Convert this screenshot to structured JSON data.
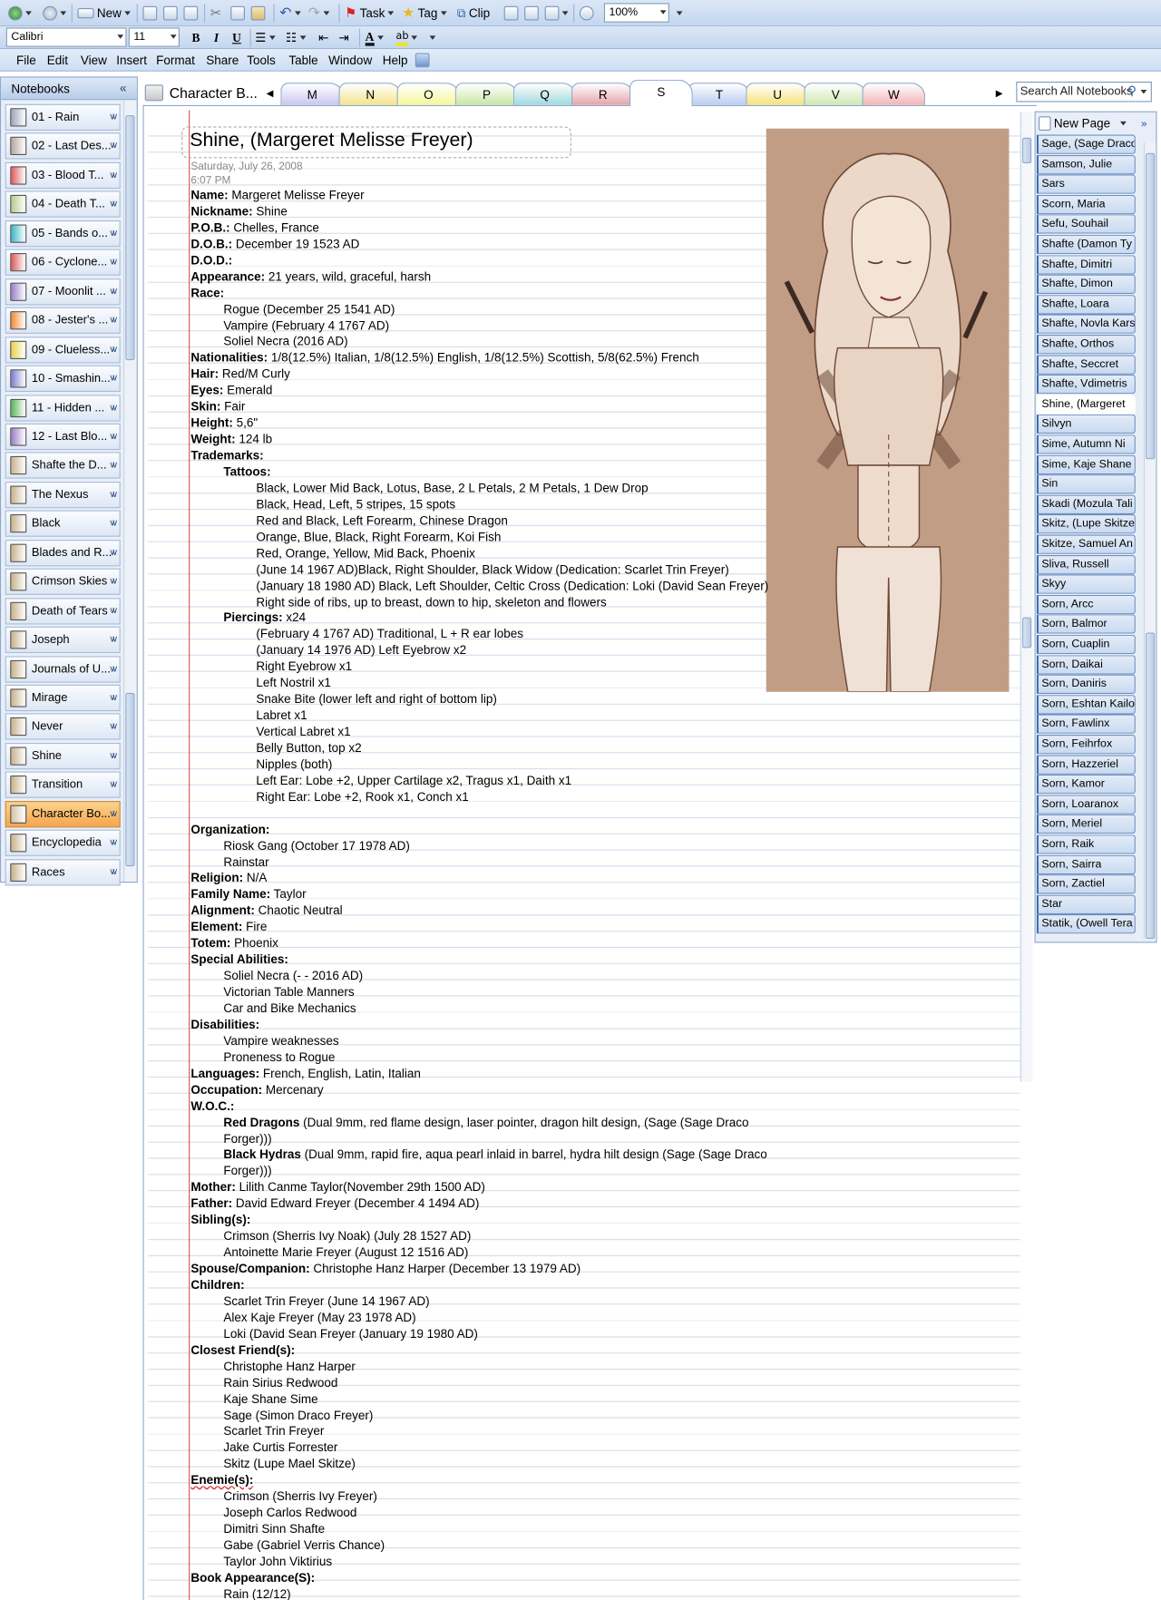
{
  "toolbar": {
    "new_label": "New",
    "task_label": "Task",
    "tag_label": "Tag",
    "clip_label": "Clip",
    "zoom": "100%",
    "font": "Calibri",
    "font_size": "11",
    "bold": "B",
    "italic": "I",
    "underline": "U"
  },
  "menu": [
    "File",
    "Edit",
    "View",
    "Insert",
    "Format",
    "Share",
    "Tools",
    "Table",
    "Window",
    "Help"
  ],
  "nav": {
    "title": "Notebooks",
    "collapse": "«",
    "items": [
      {
        "label": "01 - Rain",
        "color": "#9aa6b8"
      },
      {
        "label": "02 - Last Des...",
        "color": "#b7a6a0"
      },
      {
        "label": "03 - Blood T...",
        "color": "#e05a5a"
      },
      {
        "label": "04 - Death T...",
        "color": "#b9c98a"
      },
      {
        "label": "05 - Bands o...",
        "color": "#39b7c9"
      },
      {
        "label": "06 - Cyclone...",
        "color": "#e05a5a"
      },
      {
        "label": "07 - Moonlit ...",
        "color": "#9a7fc6"
      },
      {
        "label": "08 - Jester's ...",
        "color": "#f08a3a"
      },
      {
        "label": "09 - Clueless...",
        "color": "#e8d34a"
      },
      {
        "label": "10 - Smashin...",
        "color": "#7b7fd0"
      },
      {
        "label": "11 - Hidden ...",
        "color": "#5ab55a"
      },
      {
        "label": "12 - Last Blo...",
        "color": "#9a7fc6"
      },
      {
        "label": "Shafte the D...",
        "color": "#c8b28a"
      },
      {
        "label": "The Nexus",
        "color": "#c8b28a"
      },
      {
        "label": "Black",
        "color": "#c8b28a"
      },
      {
        "label": "Blades and R...",
        "color": "#c8b28a"
      },
      {
        "label": "Crimson Skies",
        "color": "#c8b28a"
      },
      {
        "label": "Death of Tears",
        "color": "#c8b28a"
      },
      {
        "label": "Joseph",
        "color": "#c8b28a"
      },
      {
        "label": "Journals of U...",
        "color": "#c8b28a"
      },
      {
        "label": "Mirage",
        "color": "#c8b28a"
      },
      {
        "label": "Never",
        "color": "#c8b28a"
      },
      {
        "label": "Shine",
        "color": "#c8b28a"
      },
      {
        "label": "Transition",
        "color": "#c8b28a"
      },
      {
        "label": "Character Bo...",
        "color": "#d4c3a6",
        "active": true
      },
      {
        "label": "Encyclopedia",
        "color": "#c8b28a"
      },
      {
        "label": "Races",
        "color": "#c8b28a"
      }
    ]
  },
  "notebook_title": "Character B...",
  "sections": [
    {
      "label": "M",
      "color": "#c9c7f0"
    },
    {
      "label": "N",
      "color": "#f4e38a"
    },
    {
      "label": "O",
      "color": "#f6f79a"
    },
    {
      "label": "P",
      "color": "#c8e6a4"
    },
    {
      "label": "Q",
      "color": "#9fd8df"
    },
    {
      "label": "R",
      "color": "#e4a3a8"
    },
    {
      "label": "S",
      "color": "#ffffff"
    },
    {
      "label": "T",
      "color": "#b9cdf0"
    },
    {
      "label": "U",
      "color": "#f6e27a"
    },
    {
      "label": "V",
      "color": "#cfe8b1"
    },
    {
      "label": "W",
      "color": "#f2b3b6"
    }
  ],
  "search_placeholder": "Search All Notebooks",
  "page": {
    "title": "Shine, (Margeret Melisse Freyer)",
    "date": "Saturday, July 26, 2008",
    "time": "6:07 PM",
    "lines": [
      {
        "l": "Name:",
        "t": " Margeret Melisse Freyer",
        "i": 0
      },
      {
        "l": "Nickname:",
        "t": " Shine",
        "i": 0
      },
      {
        "l": "P.O.B.:",
        "t": " Chelles, France",
        "i": 0
      },
      {
        "l": "D.O.B.:",
        "t": " December 19 1523  AD",
        "i": 0
      },
      {
        "l": "D.O.D.:",
        "t": "",
        "i": 0
      },
      {
        "l": "Appearance:",
        "t": " 21 years, wild, graceful, harsh",
        "i": 0
      },
      {
        "l": "Race:",
        "t": "",
        "i": 0
      },
      {
        "l": "",
        "t": "Rogue (December 25 1541 AD)",
        "i": 1
      },
      {
        "l": "",
        "t": "Vampire (February 4 1767 AD)",
        "i": 1
      },
      {
        "l": "",
        "t": "Soliel Necra (2016 AD)",
        "i": 1
      },
      {
        "l": "Nationalities:",
        "t": " 1/8(12.5%) Italian, 1/8(12.5%) English, 1/8(12.5%) Scottish, 5/8(62.5%) French",
        "i": 0
      },
      {
        "l": "Hair:",
        "t": " Red/M Curly",
        "i": 0
      },
      {
        "l": "Eyes:",
        "t": "  Emerald",
        "i": 0
      },
      {
        "l": "Skin:",
        "t": " Fair",
        "i": 0
      },
      {
        "l": "Height:",
        "t": " 5,6\"",
        "i": 0
      },
      {
        "l": "Weight:",
        "t": " 124 lb",
        "i": 0
      },
      {
        "l": "Trademarks:",
        "t": "",
        "i": 0
      },
      {
        "l": "Tattoos:",
        "t": "",
        "i": 1
      },
      {
        "l": "",
        "t": "Black, Lower Mid Back, Lotus, Base, 2 L Petals, 2 M Petals, 1 Dew Drop",
        "i": 2
      },
      {
        "l": "",
        "t": "Black, Head, Left, 5 stripes, 15 spots",
        "i": 2
      },
      {
        "l": "",
        "t": "Red and Black, Left Forearm, Chinese Dragon",
        "i": 2
      },
      {
        "l": "",
        "t": "Orange, Blue, Black, Right Forearm, Koi Fish",
        "i": 2
      },
      {
        "l": "",
        "t": "Red, Orange, Yellow, Mid Back, Phoenix",
        "i": 2
      },
      {
        "l": "",
        "t": "(June 14 1967  AD)Black, Right Shoulder, Black Widow (Dedication: Scarlet Trin Freyer)",
        "i": 2
      },
      {
        "l": "",
        "t": "(January 18 1980  AD) Black, Left Shoulder, Celtic Cross (Dedication: Loki (David Sean Freyer)",
        "i": 2
      },
      {
        "l": "",
        "t": "Right side of ribs, up to breast, down to hip, skeleton and flowers",
        "i": 2
      },
      {
        "l": "Piercings:",
        "t": " x24",
        "i": 1
      },
      {
        "l": "",
        "t": "(February 4 1767  AD) Traditional, L + R ear lobes",
        "i": 2
      },
      {
        "l": "",
        "t": "(January 14 1976  AD) Left Eyebrow  x2",
        "i": 2
      },
      {
        "l": "",
        "t": "Right Eyebrow x1",
        "i": 2
      },
      {
        "l": "",
        "t": "Left Nostril x1",
        "i": 2
      },
      {
        "l": "",
        "t": "Snake Bite (lower left and right of bottom lip)",
        "i": 2
      },
      {
        "l": "",
        "t": "Labret x1",
        "i": 2
      },
      {
        "l": "",
        "t": "Vertical Labret x1",
        "i": 2
      },
      {
        "l": "",
        "t": "Belly Button, top x2",
        "i": 2
      },
      {
        "l": "",
        "t": "Nipples (both)",
        "i": 2
      },
      {
        "l": "",
        "t": "Left Ear: Lobe +2,  Upper Cartilage x2, Tragus x1, Daith x1",
        "i": 2
      },
      {
        "l": "",
        "t": "Right Ear: Lobe +2,  Rook x1, Conch x1",
        "i": 2
      },
      {
        "l": "",
        "t": "",
        "i": 0
      },
      {
        "l": "Organization:",
        "t": "",
        "i": 0
      },
      {
        "l": "",
        "t": "Riosk Gang (October 17 1978  AD)",
        "i": 1
      },
      {
        "l": "",
        "t": "Rainstar",
        "i": 1
      },
      {
        "l": "Religion:",
        "t": " N/A",
        "i": 0
      },
      {
        "l": "Family Name:",
        "t": " Taylor",
        "i": 0
      },
      {
        "l": "Alignment:",
        "t": " Chaotic Neutral",
        "i": 0
      },
      {
        "l": "Element:",
        "t": " Fire",
        "i": 0
      },
      {
        "l": "Totem:",
        "t": " Phoenix",
        "i": 0
      },
      {
        "l": "Special Abilities:",
        "t": "",
        "i": 0
      },
      {
        "l": "",
        "t": "Soliel Necra (- - 2016 AD)",
        "i": 1
      },
      {
        "l": "",
        "t": "Victorian Table Manners",
        "i": 1
      },
      {
        "l": "",
        "t": "Car and Bike Mechanics",
        "i": 1
      },
      {
        "l": "Disabilities:",
        "t": "",
        "i": 0
      },
      {
        "l": "",
        "t": "Vampire weaknesses",
        "i": 1
      },
      {
        "l": "",
        "t": "Proneness to Rogue",
        "i": 1
      },
      {
        "l": "Languages:",
        "t": " French, English, Latin, Italian",
        "i": 0
      },
      {
        "l": "Occupation:",
        "t": " Mercenary",
        "i": 0
      },
      {
        "l": "W.O.C.:",
        "t": "",
        "i": 0
      },
      {
        "l": "Red Dragons",
        "t": " (Dual 9mm, red flame design, laser pointer, dragon hilt design, (Sage (Sage Draco",
        "i": 1
      },
      {
        "l": "",
        "t": "Forger)))",
        "i": 1
      },
      {
        "l": "Black Hydras",
        "t": " (Dual 9mm, rapid fire, aqua pearl inlaid in barrel, hydra hilt design (Sage (Sage Draco",
        "i": 1
      },
      {
        "l": "",
        "t": "Forger)))",
        "i": 1
      },
      {
        "l": "Mother:",
        "t": " Lilith Canme Taylor(November 29th 1500 AD)",
        "i": 0
      },
      {
        "l": "Father:",
        "t": " David Edward Freyer (December 4 1494  AD)",
        "i": 0
      },
      {
        "l": "Sibling(s):",
        "t": "",
        "i": 0
      },
      {
        "l": "",
        "t": "Crimson (Sherris Ivy Noak)  (July 28 1527 AD)",
        "i": 1
      },
      {
        "l": "",
        "t": "Antoinette Marie Freyer (August 12 1516 AD)",
        "i": 1
      },
      {
        "l": "Spouse/Companion:",
        "t": " Christophe Hanz Harper (December 13 1979  AD)",
        "i": 0
      },
      {
        "l": "Children:",
        "t": "",
        "i": 0
      },
      {
        "l": "",
        "t": "Scarlet Trin Freyer (June 14 1967  AD)",
        "i": 1
      },
      {
        "l": "",
        "t": "Alex Kaje Freyer (May 23 1978  AD)",
        "i": 1
      },
      {
        "l": "",
        "t": "Loki (David Sean Freyer (January 19 1980  AD)",
        "i": 1
      },
      {
        "l": "Closest Friend(s):",
        "t": "",
        "i": 0
      },
      {
        "l": "",
        "t": "Christophe Hanz Harper",
        "i": 1
      },
      {
        "l": "",
        "t": "Rain Sirius Redwood",
        "i": 1
      },
      {
        "l": "",
        "t": "Kaje Shane Sime",
        "i": 1
      },
      {
        "l": "",
        "t": "Sage (Simon Draco Freyer)",
        "i": 1
      },
      {
        "l": "",
        "t": "Scarlet Trin Freyer",
        "i": 1
      },
      {
        "l": "",
        "t": "Jake Curtis Forrester",
        "i": 1
      },
      {
        "l": "",
        "t": "Skitz (Lupe Mael Skitze)",
        "i": 1
      },
      {
        "l": "Enemie(s):",
        "t": "",
        "i": 0
      },
      {
        "l": "",
        "t": "Crimson (Sherris Ivy Freyer)",
        "i": 1
      },
      {
        "l": "",
        "t": "Joseph Carlos Redwood",
        "i": 1
      },
      {
        "l": "",
        "t": "Dimitri Sinn Shafte",
        "i": 1
      },
      {
        "l": "",
        "t": "Gabe (Gabriel Verris Chance)",
        "i": 1
      },
      {
        "l": "",
        "t": "Taylor John Viktirius",
        "i": 1
      },
      {
        "l": "Book Appearance(S):",
        "t": "",
        "i": 0
      },
      {
        "l": "",
        "t": "Rain (12/12)",
        "i": 1
      }
    ]
  },
  "pages_panel": {
    "new_page": "New Page",
    "items": [
      "Sage, (Sage Draco",
      "Samson, Julie",
      "Sars",
      "Scorn, Maria",
      "Sefu, Souhail",
      "Shafte (Damon Ty",
      "Shafte, Dimitri",
      "Shafte, Dimon",
      "Shafte, Loara",
      "Shafte, Novla Kars",
      "Shafte, Orthos",
      "Shafte, Seccret",
      "Shafte, Vdimetris",
      "Shine, (Margeret",
      "Silvyn",
      "Sime, Autumn Ni",
      "Sime, Kaje Shane",
      "Sin",
      "Skadi (Mozula Tali",
      "Skitz, (Lupe Skitze",
      "Skitze, Samuel An",
      "Sliva, Russell",
      "Skyy",
      "Sorn, Arcc",
      "Sorn, Balmor",
      "Sorn, Cuaplin",
      "Sorn, Daikai",
      "Sorn, Daniris",
      "Sorn, Eshtan Kailo",
      "Sorn, Fawlinx",
      "Sorn, Feihrfox",
      "Sorn, Hazzeriel",
      "Sorn, Kamor",
      "Sorn, Loaranox",
      "Sorn, Meriel",
      "Sorn, Raik",
      "Sorn, Sairra",
      "Sorn, Zactiel",
      "Star",
      "Statik, (Owell Tera"
    ],
    "current": 13
  }
}
